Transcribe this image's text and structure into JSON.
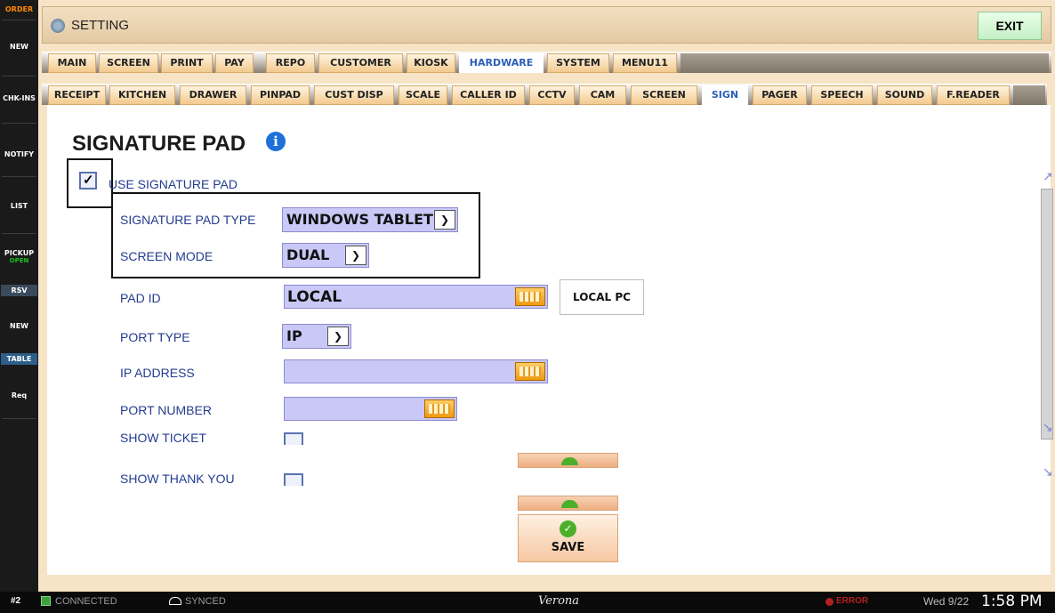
{
  "sidebar": {
    "order": "ORDER",
    "items": [
      "NEW",
      "CHK-INS",
      "NOTIFY",
      "LIST",
      "PICKUP"
    ],
    "pickup_sub": "OPEN",
    "rsv": "RSV",
    "new2": "NEW",
    "table": "TABLE",
    "req": "Req"
  },
  "header": {
    "title": "SETTING",
    "exit_label": "EXIT"
  },
  "tabs_main": [
    "MAIN",
    "SCREEN",
    "PRINT",
    "PAY",
    "REPO",
    "CUSTOMER",
    "KIOSK",
    "HARDWARE",
    "SYSTEM",
    "MENU11"
  ],
  "tabs_main_active": "HARDWARE",
  "tabs_hw": [
    "RECEIPT",
    "KITCHEN",
    "DRAWER",
    "PINPAD",
    "CUST DISP",
    "SCALE",
    "CALLER ID",
    "CCTV",
    "CAM",
    "SCREEN",
    "SIGN",
    "PAGER",
    "SPEECH",
    "SOUND",
    "F.READER"
  ],
  "tabs_hw_active": "SIGN",
  "page": {
    "heading": "SIGNATURE PAD",
    "use_signature_pad": {
      "label": "USE SIGNATURE PAD",
      "checked": true
    },
    "pad_type": {
      "label": "SIGNATURE PAD TYPE",
      "value": "WINDOWS TABLET"
    },
    "screen_mode": {
      "label": "SCREEN MODE",
      "value": "DUAL"
    },
    "pad_id": {
      "label": "PAD ID",
      "value": "LOCAL",
      "button": "LOCAL PC"
    },
    "port_type": {
      "label": "PORT TYPE",
      "value": "IP"
    },
    "ip_address": {
      "label": "IP ADDRESS",
      "value": ""
    },
    "port_number": {
      "label": "PORT NUMBER",
      "value": ""
    },
    "show_ticket": {
      "label": "SHOW TICKET",
      "checked": false
    },
    "show_thank_you": {
      "label": "SHOW THANK YOU",
      "checked": false
    },
    "save_label": "SAVE"
  },
  "status": {
    "station": "#2",
    "connected": "CONNECTED",
    "synced": "SYNCED",
    "brand": "Verona",
    "error": "ERROR",
    "date": "Wed 9/22",
    "time": "1:58 PM"
  },
  "colors": {
    "field_bg": "#c9c8f6",
    "tab_bg": "#f2c98e",
    "active_tab_text": "#2a5fb7",
    "label_text": "#233c8f"
  }
}
